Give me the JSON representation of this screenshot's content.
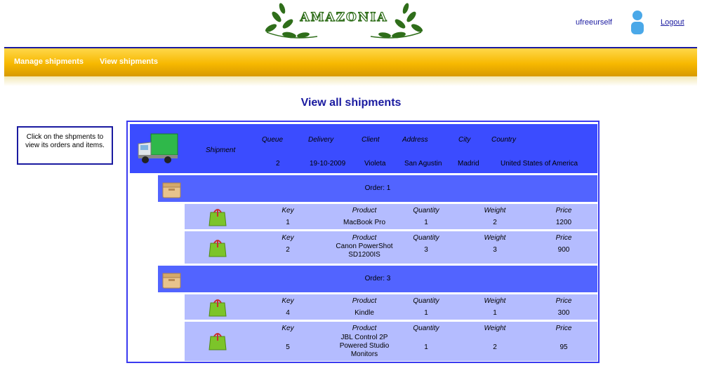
{
  "header": {
    "logo_text": "AMAZONIA",
    "username": "ufreeurself",
    "logout_label": "Logout"
  },
  "nav": {
    "items": [
      {
        "label": "Manage shipments"
      },
      {
        "label": "View shipments"
      }
    ]
  },
  "page_title": "View all shipments",
  "hint": "Click on the shpments to view its orders and items.",
  "shipment": {
    "label": "Shipment",
    "columns": [
      "Queue",
      "Delivery",
      "Client",
      "Address",
      "City",
      "Country"
    ],
    "values": [
      "2",
      "19-10-2009",
      "Violeta",
      "San Agustin",
      "Madrid",
      "United States of America"
    ]
  },
  "item_columns": [
    "Key",
    "Product",
    "Quantity",
    "Weight",
    "Price"
  ],
  "orders": [
    {
      "label": "Order: 1",
      "items": [
        {
          "key": "1",
          "product": "MacBook Pro",
          "quantity": "1",
          "weight": "2",
          "price": "1200"
        },
        {
          "key": "2",
          "product": "Canon PowerShot SD1200IS",
          "quantity": "3",
          "weight": "3",
          "price": "900"
        }
      ]
    },
    {
      "label": "Order: 3",
      "items": [
        {
          "key": "4",
          "product": "Kindle",
          "quantity": "1",
          "weight": "1",
          "price": "300"
        },
        {
          "key": "5",
          "product": "JBL Control 2P Powered Studio Monitors",
          "quantity": "1",
          "weight": "2",
          "price": "95"
        }
      ]
    }
  ],
  "colors": {
    "accent_blue": "#1a1aa0",
    "shipment_row": "#3b4cff",
    "order_row": "#5264ff",
    "item_row": "#b4bcff",
    "nav_gold": "#f7b800"
  }
}
